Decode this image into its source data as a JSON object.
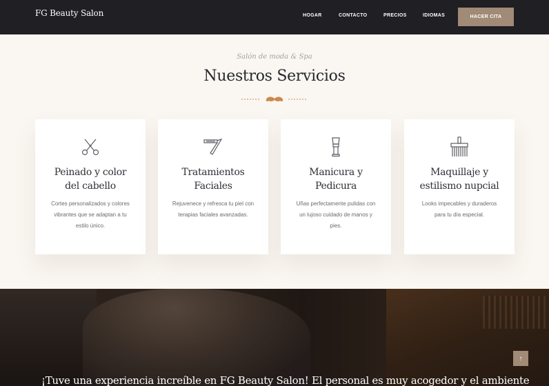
{
  "brand": "FG Beauty Salon",
  "nav": {
    "links": [
      "HOGAR",
      "CONTACTO",
      "PRECIOS",
      "IDIOMAS"
    ],
    "cta": "HACER CITA"
  },
  "section": {
    "subtitle": "Salón de moda & Spa",
    "title": "Nuestros Servicios",
    "divider_icon": "mustache-icon"
  },
  "services": [
    {
      "icon": "scissors-icon",
      "title_line1": "Peinado y color",
      "title_line2": "del cabello",
      "desc": "Cortes personalizados y colores vibrantes que se adaptan a tu estilo único."
    },
    {
      "icon": "razor-icon",
      "title_line1": "Tratamientos",
      "title_line2": "Faciales",
      "desc": "Rejuvenece y refresca tu piel con terapias faciales avanzadas."
    },
    {
      "icon": "shaving-brush-icon",
      "title_line1": "Manicura y",
      "title_line2": "Pedicura",
      "desc": "Uñas perfectamente pulidas con un lujoso cuidado de manos y pies."
    },
    {
      "icon": "comb-brush-icon",
      "title_line1": "Maquillaje y",
      "title_line2": "estilismo nupcial",
      "desc": "Looks impecables y duraderos para tu día especial."
    }
  ],
  "testimonial": {
    "quote": "¡Tuve una experiencia increíble en FG Beauty Salon! El personal es muy acogedor y el ambiente"
  },
  "scroll_top_icon": "arrow-up-icon",
  "colors": {
    "nav_bg": "#1f1f24",
    "accent": "#a18a76",
    "page_bg": "#faf6f1",
    "divider": "#c98a4b"
  }
}
